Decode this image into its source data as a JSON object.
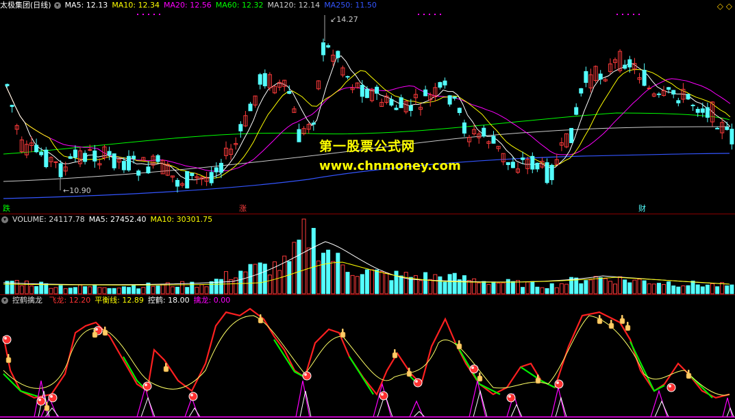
{
  "main": {
    "title": "太极集团(日线)",
    "ma": [
      {
        "label": "MA5: 12.13",
        "color": "#ffffff"
      },
      {
        "label": "MA10: 12.34",
        "color": "#ffff00"
      },
      {
        "label": "MA20: 12.56",
        "color": "#ff00ff"
      },
      {
        "label": "MA60: 12.32",
        "color": "#00ff00"
      },
      {
        "label": "MA120: 12.14",
        "color": "#cccccc"
      },
      {
        "label": "MA250: 11.50",
        "color": "#3355ff"
      }
    ],
    "high_label": "14.27",
    "low_label": "10.90",
    "tags": {
      "die": "跌",
      "zhang": "涨",
      "cai": "财"
    }
  },
  "volume": {
    "items": [
      {
        "label": "VOLUME: 24117.78",
        "color": "#dddddd"
      },
      {
        "label": "MA5: 27452.40",
        "color": "#ffffff"
      },
      {
        "label": "MA10: 30301.75",
        "color": "#ffff00"
      }
    ]
  },
  "indicator": {
    "name": "控鹤擒龙",
    "items": [
      {
        "label": "飞龙: 12.20",
        "color": "#ff3333"
      },
      {
        "label": "平衡线: 12.89",
        "color": "#ffff00"
      },
      {
        "label": "控鹤: 18.00",
        "color": "#ffffff"
      },
      {
        "label": "擒龙: 0.00",
        "color": "#ff00ff"
      }
    ]
  },
  "watermark": {
    "line1": "第一股票公式网",
    "line2": "www.chnmoney.com"
  },
  "colors": {
    "up": "#ff3b3b",
    "down": "#54ffff",
    "ma5": "#ffffff",
    "ma10": "#ffff00",
    "ma20": "#ff00ff",
    "ma60": "#00ff00",
    "ma120": "#cccccc",
    "ma250": "#3355ff"
  }
}
